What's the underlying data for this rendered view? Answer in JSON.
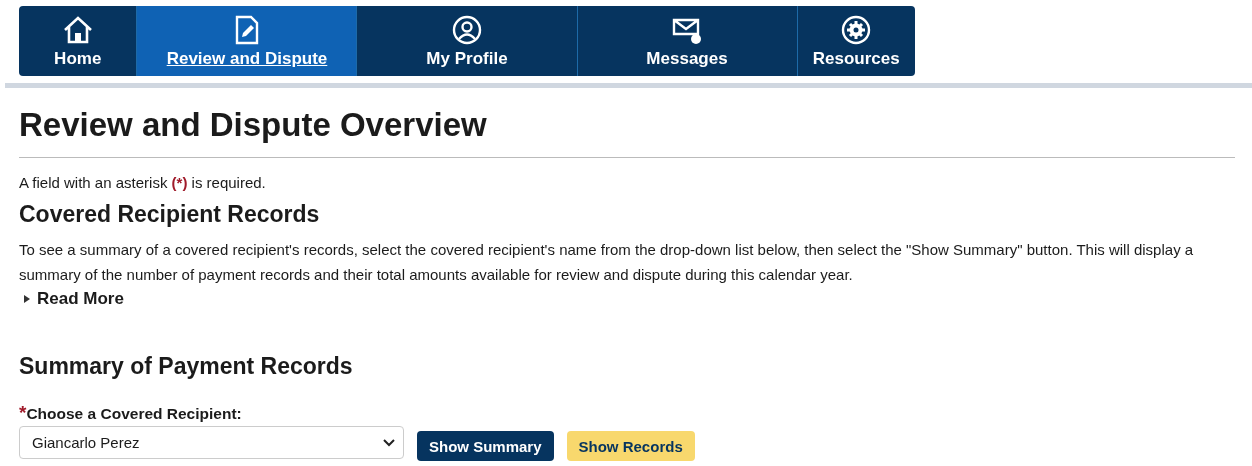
{
  "nav": [
    {
      "label": "Home",
      "kind": "home",
      "selected": false
    },
    {
      "label": "Review and Dispute",
      "kind": "edit",
      "selected": true
    },
    {
      "label": "My Profile",
      "kind": "profile",
      "selected": false
    },
    {
      "label": "Messages",
      "kind": "mail",
      "selected": false
    },
    {
      "label": "Resources",
      "kind": "gear",
      "selected": false
    }
  ],
  "page_title": "Review and Dispute Overview",
  "required_note": "A field with an asterisk **(*)** is required.",
  "section_title": "Covered Recipient Records",
  "section_text": "To see a summary of a covered recipient's records, select the covered recipient's name from the drop-down list below, then select the \"Show Summary\" button. This will display a summary of the number of payment records and their total amounts available for review and dispute during this calendar year.",
  "read_more": {
    "label": "Read More",
    "expanded": false
  },
  "summary_title": "Summary of Payment Records",
  "recipient_field": {
    "required_mark": "*",
    "label": "Choose a Covered Recipient:",
    "value": "Giancarlo Perez"
  },
  "buttons": [
    {
      "label": "Show Summary",
      "kind": "primary"
    },
    {
      "label": "Show Records",
      "kind": "secondary"
    }
  ]
}
